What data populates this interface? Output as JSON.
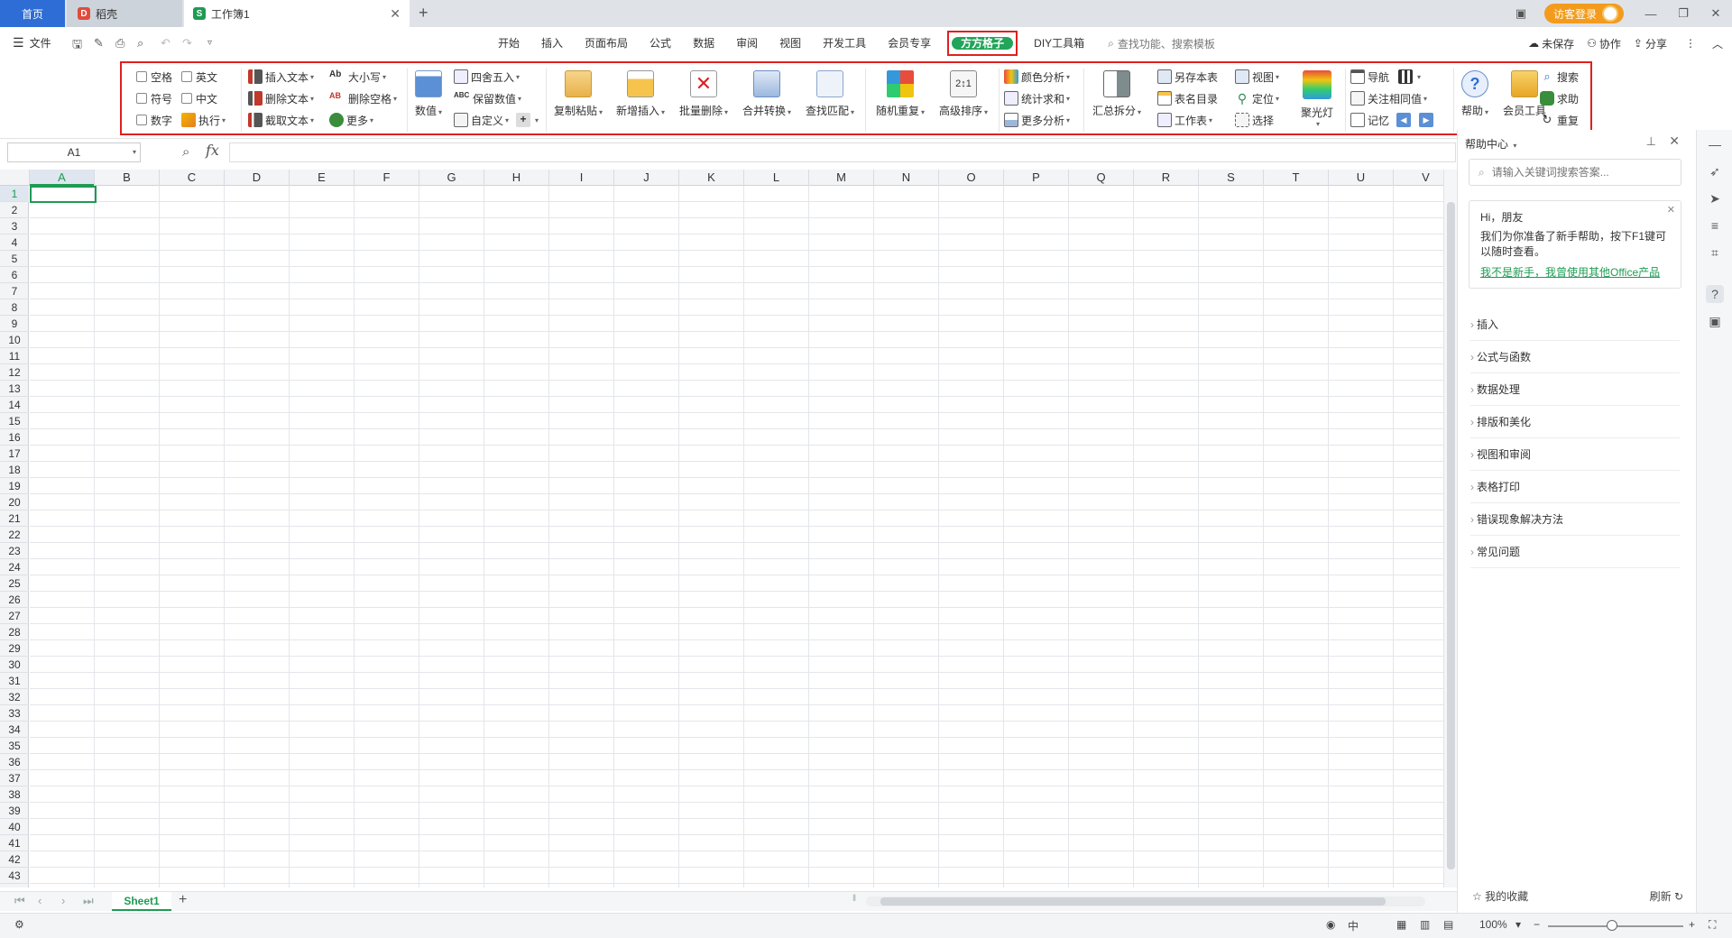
{
  "tabs": {
    "home": "首页",
    "daoke": "稻壳",
    "workbook": "工作簿1",
    "visitor_login": "访客登录"
  },
  "menu": {
    "file": "文件",
    "tabs": [
      "开始",
      "插入",
      "页面布局",
      "公式",
      "数据",
      "审阅",
      "视图",
      "开发工具",
      "会员专享"
    ],
    "active_tab": "方方格子",
    "diy_tab": "DIY工具箱",
    "search_placeholder": "查找功能、搜索模板",
    "unsaved": "未保存",
    "collaborate": "协作",
    "share": "分享"
  },
  "ribbon": {
    "cb_space": "空格",
    "cb_english": "英文",
    "cb_symbol": "符号",
    "cb_chinese": "中文",
    "cb_number": "数字",
    "execute": "执行",
    "insert_text": "插入文本",
    "delete_text": "删除文本",
    "extract_text": "截取文本",
    "case": "大小写",
    "delete_space": "删除空格",
    "more": "更多",
    "value": "数值",
    "round": "四舍五入",
    "keep_value": "保留数值",
    "custom": "自定义",
    "copy_paste": "复制粘贴",
    "new_insert": "新增插入",
    "batch_delete": "批量删除",
    "merge_convert": "合并转换",
    "find_match": "查找匹配",
    "random_repeat": "随机重复",
    "advanced_sort": "高级排序",
    "color_analysis": "颜色分析",
    "stat_sum": "统计求和",
    "more_analysis": "更多分析",
    "summary_split": "汇总拆分",
    "save_sheet": "另存本表",
    "sheet_dir": "表名目录",
    "worksheet": "工作表",
    "view": "视图",
    "locate": "定位",
    "select": "选择",
    "spotlight": "聚光灯",
    "navigate": "导航",
    "focus_same": "关注相同值",
    "memory": "记忆",
    "help": "帮助",
    "member_tools": "会员工具",
    "search": "搜索",
    "ask_help": "求助",
    "repeat": "重复"
  },
  "formula_bar": {
    "name_box": "A1",
    "fx": "fx"
  },
  "grid": {
    "columns": [
      "A",
      "B",
      "C",
      "D",
      "E",
      "F",
      "G",
      "H",
      "I",
      "J",
      "K",
      "L",
      "M",
      "N",
      "O",
      "P",
      "Q",
      "R",
      "S",
      "T",
      "U",
      "V"
    ],
    "rows": [
      "1",
      "2",
      "3",
      "4",
      "5",
      "6",
      "7",
      "8",
      "9",
      "10",
      "11",
      "12",
      "13",
      "14",
      "15",
      "16",
      "17",
      "18",
      "19",
      "20",
      "21",
      "22",
      "23",
      "24",
      "25",
      "26",
      "27",
      "28",
      "29",
      "30",
      "31",
      "32",
      "33",
      "34",
      "35",
      "36",
      "37",
      "38",
      "39",
      "40",
      "41",
      "42",
      "43"
    ],
    "selected_cell": "A1"
  },
  "sheets": {
    "active": "Sheet1"
  },
  "status": {
    "zoom": "100%",
    "ime": "中"
  },
  "help_panel": {
    "title": "帮助中心",
    "search_placeholder": "请输入关键词搜索答案...",
    "greeting": "Hi，朋友",
    "message": "我们为你准备了新手帮助，按下F1键可以随时查看。",
    "link": "我不是新手，我曾使用其他Office产品",
    "items": [
      "插入",
      "公式与函数",
      "数据处理",
      "排版和美化",
      "视图和审阅",
      "表格打印",
      "错误现象解决方法",
      "常见问题"
    ],
    "favorites": "我的收藏",
    "refresh": "刷新"
  },
  "colors": {
    "accent_green": "#1e9b52",
    "highlight_red": "#e02020",
    "tab_blue": "#2e6cd6"
  }
}
